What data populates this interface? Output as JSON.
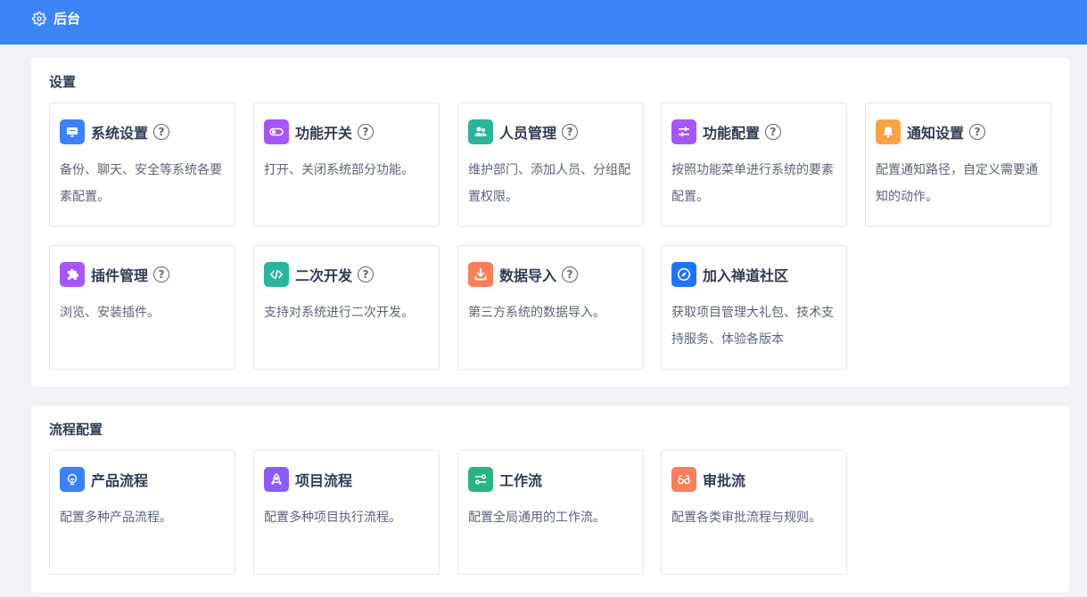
{
  "header": {
    "title": "后台",
    "icon": "gear-icon"
  },
  "sections": [
    {
      "title": "设置",
      "cards": [
        {
          "title": "系统设置",
          "desc": "备份、聊天、安全等系统各要素配置。",
          "help": true,
          "icon": "monitor-icon",
          "color": "#3b82f6"
        },
        {
          "title": "功能开关",
          "desc": "打开、关闭系统部分功能。",
          "help": true,
          "icon": "toggle-icon",
          "color": "#a855f7"
        },
        {
          "title": "人员管理",
          "desc": "维护部门、添加人员、分组配置权限。",
          "help": true,
          "icon": "users-icon",
          "color": "#2ab49a"
        },
        {
          "title": "功能配置",
          "desc": "按照功能菜单进行系统的要素配置。",
          "help": true,
          "icon": "sliders-icon",
          "color": "#a855f7"
        },
        {
          "title": "通知设置",
          "desc": "配置通知路径，自定义需要通知的动作。",
          "help": true,
          "icon": "bell-icon",
          "color": "#f9a344"
        },
        {
          "title": "插件管理",
          "desc": "浏览、安装插件。",
          "help": true,
          "icon": "puzzle-icon",
          "color": "#a855f7"
        },
        {
          "title": "二次开发",
          "desc": "支持对系统进行二次开发。",
          "help": true,
          "icon": "code-icon",
          "color": "#2ab49a"
        },
        {
          "title": "数据导入",
          "desc": "第三方系统的数据导入。",
          "help": true,
          "icon": "download-icon",
          "color": "#f77f5a"
        },
        {
          "title": "加入禅道社区",
          "desc": "获取项目管理大礼包、技术支持服务、体验各版本",
          "help": false,
          "icon": "compass-icon",
          "color": "#1d74f5"
        }
      ]
    },
    {
      "title": "流程配置",
      "cards": [
        {
          "title": "产品流程",
          "desc": "配置多种产品流程。",
          "help": false,
          "icon": "lightbulb-icon",
          "color": "#3b82f6"
        },
        {
          "title": "项目流程",
          "desc": "配置多种项目执行流程。",
          "help": false,
          "icon": "rocket-icon",
          "color": "#8b5cf6"
        },
        {
          "title": "工作流",
          "desc": "配置全局通用的工作流。",
          "help": false,
          "icon": "flow-icon",
          "color": "#2ab480"
        },
        {
          "title": "审批流",
          "desc": "配置各类审批流程与规则。",
          "help": false,
          "icon": "glasses-icon",
          "color": "#f77f5a"
        }
      ]
    }
  ],
  "help_glyph": "?"
}
